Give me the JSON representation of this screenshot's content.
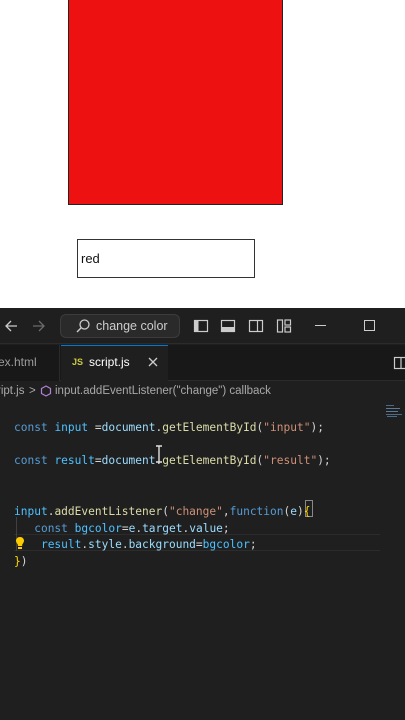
{
  "preview": {
    "result_color": "#ee1111",
    "input_value": "red"
  },
  "titlebar": {
    "command_center_label": "change color",
    "icons": [
      "back-icon",
      "forward-icon",
      "search-icon",
      "toggle-sidebar-icon",
      "toggle-panel-icon",
      "toggle-secondary-sidebar-icon",
      "customize-layout-icon",
      "minimize-icon",
      "maximize-icon"
    ]
  },
  "tabs": [
    {
      "label": "ex.html",
      "active": false
    },
    {
      "label": "script.js",
      "badge": "JS",
      "active": true
    }
  ],
  "breadcrumb": {
    "file": "ript.js",
    "separator": ">",
    "symbol": "input.addEventListener(\"change\") callback"
  },
  "code": {
    "line1": {
      "kw": "const",
      "name": "input",
      "rest": " =",
      "obj": "document",
      "fn": "getElementById",
      "arg": "\"input\"",
      "end": ");"
    },
    "line2": {
      "kw": "const",
      "name": "result",
      "rest": "=",
      "obj": "document",
      "fn": "getElementById",
      "arg": "\"result\"",
      "end": ");"
    },
    "line3": {
      "obj": "input",
      "fn": "addEventListener",
      "arg": "\"change\"",
      "kw": "function",
      "param": "e"
    },
    "line4": {
      "kw": "const",
      "name": "bgcolor",
      "expr1": "e",
      "expr2": "target",
      "expr3": "value"
    },
    "line5": {
      "obj": "result",
      "p1": "style",
      "p2": "background",
      "val": "bgcolor"
    },
    "line6": {
      "close": ")"
    }
  },
  "colors": {
    "accent": "#0078d4",
    "editor_bg": "#1f1f1f",
    "keyword": "#569cd6",
    "string": "#ce9178",
    "function": "#dcdcaa",
    "variable": "#9cdcfe"
  }
}
